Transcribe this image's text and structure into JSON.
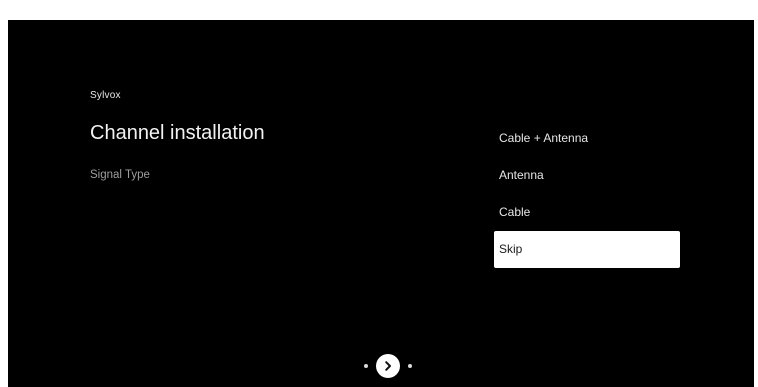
{
  "header": {
    "brand": "Sylvox",
    "title": "Channel installation",
    "subtitle": "Signal Type"
  },
  "signal_options": [
    {
      "label": "Cable + Antenna",
      "selected": false
    },
    {
      "label": "Antenna",
      "selected": false
    },
    {
      "label": "Cable",
      "selected": false
    },
    {
      "label": "Skip",
      "selected": true
    }
  ],
  "navigation": {
    "next_icon": "chevron-right-icon"
  },
  "colors": {
    "background": "#000000",
    "selected_background": "#ffffff",
    "text": "#e6e6e6",
    "muted_text": "#9e9e9e"
  }
}
